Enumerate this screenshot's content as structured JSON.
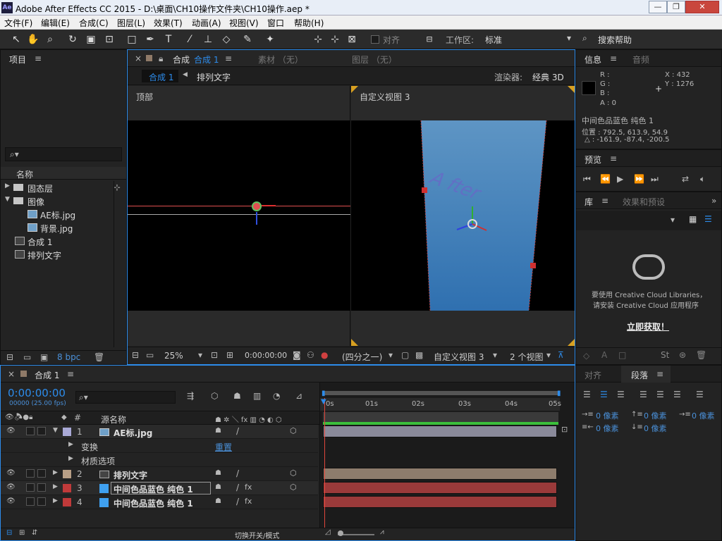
{
  "window": {
    "title": "Adobe After Effects CC 2015 - D:\\桌面\\CH10操作文件夹\\CH10操作.aep *",
    "app_icon": "Ae",
    "min": "—",
    "max": "❐",
    "close": "✕"
  },
  "menu": [
    "文件(F)",
    "编辑(E)",
    "合成(C)",
    "图层(L)",
    "效果(T)",
    "动画(A)",
    "视图(V)",
    "窗口",
    "帮助(H)"
  ],
  "toolbar": {
    "snap_label": "对齐",
    "workspace_label": "工作区:",
    "workspace_value": "标准",
    "search_help": "搜索帮助"
  },
  "project": {
    "title": "项目",
    "col_name": "名称",
    "items": [
      {
        "name": "固态层",
        "type": "folder"
      },
      {
        "name": "图像",
        "type": "folder"
      },
      {
        "name": "AE标.jpg",
        "type": "image"
      },
      {
        "name": "背景.jpg",
        "type": "image"
      },
      {
        "name": "合成 1",
        "type": "comp"
      },
      {
        "name": "排列文字",
        "type": "comp"
      }
    ],
    "bpc": "8 bpc"
  },
  "viewer": {
    "tab_comp_prefix": "合成",
    "tab_comp_name": "合成 1",
    "tab_footage": "素材 （无）",
    "tab_layer": "图层 （无）",
    "crumb_active": "合成 1",
    "crumb_next": "排列文字",
    "renderer_label": "渲染器:",
    "renderer_value": "经典 3D",
    "view_left": "顶部",
    "view_right": "自定义视图 3",
    "zoom": "25%",
    "timecode": "0:00:00:00",
    "resolution": "(四分之一)",
    "view_select": "自定义视图 3",
    "views_count": "2 个视图",
    "overlay_text": "A fter"
  },
  "info": {
    "tab_info": "信息",
    "tab_audio": "音频",
    "r": "R :",
    "g": "G :",
    "b": "B :",
    "a": "A : 0",
    "x": "X : 432",
    "y": "Y : 1276",
    "layer": "中间色品蓝色 纯色 1",
    "position": "位置 : 792.5, 613.9, 54.9",
    "delta": "△ : -161.9, -87.4, -200.5"
  },
  "preview": {
    "title": "预览"
  },
  "library": {
    "tab_lib": "库",
    "tab_effects": "效果和预设",
    "msg_line1": "要使用 Creative Cloud Libraries，",
    "msg_line2": "请安装 Creative Cloud 应用程序",
    "install_link": "立即获取！"
  },
  "timeline": {
    "tab": "合成 1",
    "timecode": "0:00:00:00",
    "frames": "00000 (25.00 fps)",
    "col_source": "源名称",
    "ruler": [
      "0s",
      "01s",
      "02s",
      "03s",
      "04s",
      "05s"
    ],
    "layers": [
      {
        "num": "1",
        "name": "AE标.jpg",
        "color": "#a9a9d6",
        "kind": "image"
      },
      {
        "num": "",
        "name": "变换",
        "sub": true,
        "reset": "重置"
      },
      {
        "num": "",
        "name": "材质选项",
        "sub": true
      },
      {
        "num": "2",
        "name": "排列文字",
        "color": "#b89f86",
        "kind": "comp"
      },
      {
        "num": "3",
        "name": "中间色品蓝色 纯色 1",
        "color": "#c03a3a",
        "kind": "solid"
      },
      {
        "num": "4",
        "name": "中间色品蓝色 纯色 1",
        "color": "#c03a3a",
        "kind": "solid"
      }
    ],
    "footer_toggle": "切换开关/模式"
  },
  "paragraph": {
    "tab_align": "对齐",
    "tab_para": "段落",
    "px1": "0 像素",
    "px2": "0 像素",
    "px3": "0 像素",
    "px4": "0 像素",
    "px5": "0 像素"
  },
  "colors": {
    "accent_blue": "#2d8ceb",
    "playhead": "#e0463c",
    "bar_image": "#8a8a9a",
    "bar_comp": "#8d7c6c",
    "bar_solid": "#9a3a3a",
    "viewer_blue": "#3f7fb5"
  }
}
